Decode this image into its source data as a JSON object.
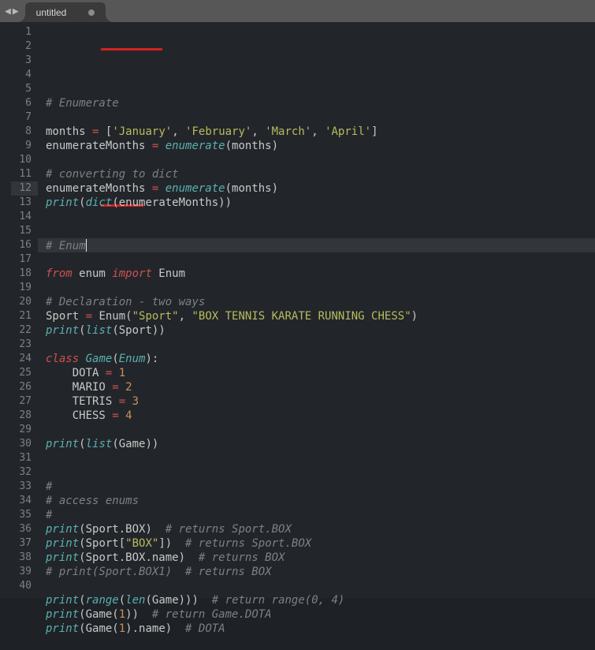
{
  "tab": {
    "title": "untitled"
  },
  "editor": {
    "line_count": 40,
    "active_line": 12,
    "code_lines": [
      {
        "n": 1,
        "tokens": []
      },
      {
        "n": 2,
        "tokens": [
          {
            "t": "# ",
            "c": "c"
          },
          {
            "t": "Enumerate",
            "c": "c"
          }
        ]
      },
      {
        "n": 3,
        "tokens": []
      },
      {
        "n": 4,
        "tokens": [
          {
            "t": "months ",
            "c": "id"
          },
          {
            "t": "=",
            "c": "op"
          },
          {
            "t": " ",
            "c": "pun"
          },
          {
            "t": "[",
            "c": "pun"
          },
          {
            "t": "'January'",
            "c": "s"
          },
          {
            "t": ", ",
            "c": "pun"
          },
          {
            "t": "'February'",
            "c": "s"
          },
          {
            "t": ", ",
            "c": "pun"
          },
          {
            "t": "'March'",
            "c": "s"
          },
          {
            "t": ", ",
            "c": "pun"
          },
          {
            "t": "'April'",
            "c": "s"
          },
          {
            "t": "]",
            "c": "pun"
          }
        ]
      },
      {
        "n": 5,
        "tokens": [
          {
            "t": "enumerateMonths ",
            "c": "id"
          },
          {
            "t": "=",
            "c": "op"
          },
          {
            "t": " ",
            "c": "pun"
          },
          {
            "t": "enumerate",
            "c": "fn"
          },
          {
            "t": "(months)",
            "c": "pun"
          }
        ]
      },
      {
        "n": 6,
        "tokens": []
      },
      {
        "n": 7,
        "tokens": [
          {
            "t": "# converting to dict",
            "c": "c"
          }
        ]
      },
      {
        "n": 8,
        "tokens": [
          {
            "t": "enumerateMonths ",
            "c": "id"
          },
          {
            "t": "=",
            "c": "op"
          },
          {
            "t": " ",
            "c": "pun"
          },
          {
            "t": "enumerate",
            "c": "fn"
          },
          {
            "t": "(months)",
            "c": "pun"
          }
        ]
      },
      {
        "n": 9,
        "tokens": [
          {
            "t": "print",
            "c": "fn"
          },
          {
            "t": "(",
            "c": "pun"
          },
          {
            "t": "dict",
            "c": "fn"
          },
          {
            "t": "(enumerateMonths))",
            "c": "pun"
          }
        ]
      },
      {
        "n": 10,
        "tokens": []
      },
      {
        "n": 11,
        "tokens": []
      },
      {
        "n": 12,
        "tokens": [
          {
            "t": "# ",
            "c": "c"
          },
          {
            "t": "Enum",
            "c": "c"
          },
          {
            "t": "",
            "c": "caret"
          }
        ]
      },
      {
        "n": 13,
        "tokens": []
      },
      {
        "n": 14,
        "tokens": [
          {
            "t": "from",
            "c": "kw"
          },
          {
            "t": " enum ",
            "c": "id"
          },
          {
            "t": "import",
            "c": "kw"
          },
          {
            "t": " Enum",
            "c": "id"
          }
        ]
      },
      {
        "n": 15,
        "tokens": []
      },
      {
        "n": 16,
        "tokens": [
          {
            "t": "# Declaration - two ways",
            "c": "c"
          }
        ]
      },
      {
        "n": 17,
        "tokens": [
          {
            "t": "Sport ",
            "c": "id"
          },
          {
            "t": "=",
            "c": "op"
          },
          {
            "t": " Enum(",
            "c": "pun"
          },
          {
            "t": "\"Sport\"",
            "c": "s"
          },
          {
            "t": ", ",
            "c": "pun"
          },
          {
            "t": "\"BOX TENNIS KARATE RUNNING CHESS\"",
            "c": "s"
          },
          {
            "t": ")",
            "c": "pun"
          }
        ]
      },
      {
        "n": 18,
        "tokens": [
          {
            "t": "print",
            "c": "fn"
          },
          {
            "t": "(",
            "c": "pun"
          },
          {
            "t": "list",
            "c": "fn"
          },
          {
            "t": "(Sport))",
            "c": "pun"
          }
        ]
      },
      {
        "n": 19,
        "tokens": []
      },
      {
        "n": 20,
        "tokens": [
          {
            "t": "class",
            "c": "kw"
          },
          {
            "t": " ",
            "c": "pun"
          },
          {
            "t": "Game",
            "c": "cls"
          },
          {
            "t": "(",
            "c": "pun"
          },
          {
            "t": "Enum",
            "c": "cls"
          },
          {
            "t": "):",
            "c": "pun"
          }
        ]
      },
      {
        "n": 21,
        "tokens": [
          {
            "t": "    DOTA ",
            "c": "id"
          },
          {
            "t": "=",
            "c": "op"
          },
          {
            "t": " ",
            "c": "pun"
          },
          {
            "t": "1",
            "c": "n"
          }
        ]
      },
      {
        "n": 22,
        "tokens": [
          {
            "t": "    MARIO ",
            "c": "id"
          },
          {
            "t": "=",
            "c": "op"
          },
          {
            "t": " ",
            "c": "pun"
          },
          {
            "t": "2",
            "c": "n"
          }
        ]
      },
      {
        "n": 23,
        "tokens": [
          {
            "t": "    TETRIS ",
            "c": "id"
          },
          {
            "t": "=",
            "c": "op"
          },
          {
            "t": " ",
            "c": "pun"
          },
          {
            "t": "3",
            "c": "n"
          }
        ]
      },
      {
        "n": 24,
        "tokens": [
          {
            "t": "    CHESS ",
            "c": "id"
          },
          {
            "t": "=",
            "c": "op"
          },
          {
            "t": " ",
            "c": "pun"
          },
          {
            "t": "4",
            "c": "n"
          }
        ]
      },
      {
        "n": 25,
        "tokens": []
      },
      {
        "n": 26,
        "tokens": [
          {
            "t": "print",
            "c": "fn"
          },
          {
            "t": "(",
            "c": "pun"
          },
          {
            "t": "list",
            "c": "fn"
          },
          {
            "t": "(Game))",
            "c": "pun"
          }
        ]
      },
      {
        "n": 27,
        "tokens": []
      },
      {
        "n": 28,
        "tokens": []
      },
      {
        "n": 29,
        "tokens": [
          {
            "t": "#",
            "c": "c"
          }
        ]
      },
      {
        "n": 30,
        "tokens": [
          {
            "t": "# access enums",
            "c": "c"
          }
        ]
      },
      {
        "n": 31,
        "tokens": [
          {
            "t": "#",
            "c": "c"
          }
        ]
      },
      {
        "n": 32,
        "tokens": [
          {
            "t": "print",
            "c": "fn"
          },
          {
            "t": "(Sport.BOX)  ",
            "c": "pun"
          },
          {
            "t": "# returns Sport.BOX",
            "c": "c"
          }
        ]
      },
      {
        "n": 33,
        "tokens": [
          {
            "t": "print",
            "c": "fn"
          },
          {
            "t": "(Sport[",
            "c": "pun"
          },
          {
            "t": "\"BOX\"",
            "c": "s"
          },
          {
            "t": "])  ",
            "c": "pun"
          },
          {
            "t": "# returns Sport.BOX",
            "c": "c"
          }
        ]
      },
      {
        "n": 34,
        "tokens": [
          {
            "t": "print",
            "c": "fn"
          },
          {
            "t": "(Sport.BOX.name)  ",
            "c": "pun"
          },
          {
            "t": "# returns BOX",
            "c": "c"
          }
        ]
      },
      {
        "n": 35,
        "tokens": [
          {
            "t": "# print(Sport.BOX1)  # returns BOX",
            "c": "c"
          }
        ]
      },
      {
        "n": 36,
        "tokens": []
      },
      {
        "n": 37,
        "tokens": [
          {
            "t": "print",
            "c": "fn"
          },
          {
            "t": "(",
            "c": "pun"
          },
          {
            "t": "range",
            "c": "fn"
          },
          {
            "t": "(",
            "c": "pun"
          },
          {
            "t": "len",
            "c": "fn"
          },
          {
            "t": "(Game)))  ",
            "c": "pun"
          },
          {
            "t": "# return range(0, 4)",
            "c": "c"
          }
        ]
      },
      {
        "n": 38,
        "tokens": [
          {
            "t": "print",
            "c": "fn"
          },
          {
            "t": "(Game(",
            "c": "pun"
          },
          {
            "t": "1",
            "c": "n"
          },
          {
            "t": "))  ",
            "c": "pun"
          },
          {
            "t": "# return Game.DOTA",
            "c": "c"
          }
        ]
      },
      {
        "n": 39,
        "tokens": [
          {
            "t": "print",
            "c": "fn"
          },
          {
            "t": "(Game(",
            "c": "pun"
          },
          {
            "t": "1",
            "c": "n"
          },
          {
            "t": ").name)  ",
            "c": "pun"
          },
          {
            "t": "# DOTA",
            "c": "c"
          }
        ]
      },
      {
        "n": 40,
        "tokens": []
      }
    ]
  }
}
